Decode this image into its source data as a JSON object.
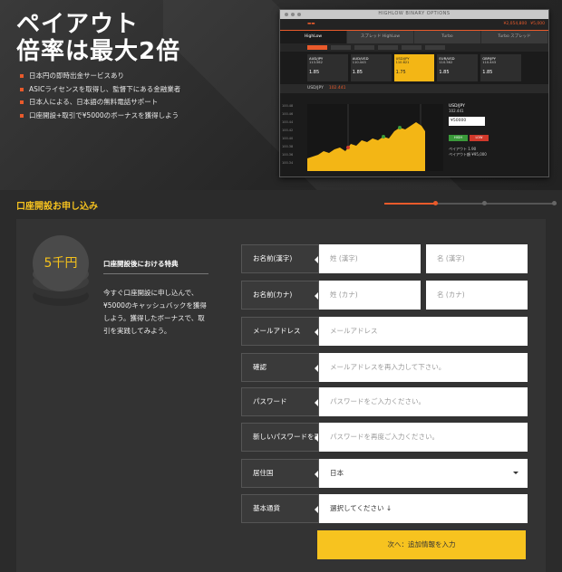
{
  "hero": {
    "title_line1": "ペイアウト",
    "title_line2": "倍率は最大2倍",
    "features": [
      "日本円の即時出金サービスあり",
      "ASICライセンスを取得し、監督下にある金融業者",
      "日本人による、日本語の無料電話サポート",
      "口座開設+取引で¥5000のボーナスを獲得しよう"
    ]
  },
  "mockup": {
    "brand": "HIGHLOW BINARY OPTIONS",
    "balance": "¥2,054,800",
    "bonus": "¥5,000",
    "tabs": [
      "HighLow",
      "スプレッド HighLow",
      "Turbo",
      "Turbo スプレッド"
    ],
    "assets": [
      {
        "name": "AUD/JPY",
        "price": "1.85"
      },
      {
        "name": "AUD/USD",
        "price": "1.85"
      },
      {
        "name": "USD/JPY",
        "price": "1.75"
      },
      {
        "name": "EUR/USD",
        "price": "1.85"
      },
      {
        "name": "GBP/JPY",
        "price": "1.85"
      }
    ],
    "asset_values": [
      "113.562",
      "110.443",
      "110.621",
      "110.562",
      "110.443"
    ],
    "pair": "USD/JPY",
    "pair_price": "102.441",
    "side_pair": "USD/JPY",
    "side_price": "102.441",
    "amount": "¥50000",
    "high_label": "HIGH",
    "low_label": "LOW",
    "payout_label": "ペイアウト",
    "payout_value": "1.90",
    "return_label": "ペイアウト額",
    "return_value": "¥95,000",
    "axis": [
      "100.48",
      "100.46",
      "100.44",
      "100.42",
      "100.40",
      "100.38",
      "100.36",
      "100.34"
    ]
  },
  "section": {
    "title": "口座開設お申し込み"
  },
  "bonus": {
    "coin_text": "5千円",
    "title": "口座開設後における特典",
    "text": "今すぐ口座開設に申し込んで、¥5000のキャッシュバックを獲得しよう。獲得したボーナスで、取引を実践してみよう。"
  },
  "form": {
    "name_kanji": {
      "label": "お名前(漢字)",
      "last": "姓 (漢字)",
      "first": "名 (漢字)"
    },
    "name_kana": {
      "label": "お名前(カナ)",
      "last": "姓 (カナ)",
      "first": "名 (カナ)"
    },
    "email": {
      "label": "メールアドレス",
      "placeholder": "メールアドレス"
    },
    "confirm": {
      "label": "確認",
      "placeholder": "メールアドレスを再入力して下さい。"
    },
    "password": {
      "label": "パスワード",
      "placeholder": "パスワードをご入力ください。"
    },
    "password_new": {
      "label": "新しいパスワードを再",
      "placeholder": "パスワードを再度ご入力ください。"
    },
    "country": {
      "label": "居住国",
      "value": "日本"
    },
    "currency": {
      "label": "基本通貨",
      "value": "選択してください ↓"
    },
    "next_label": "次へ：追加情報を入力"
  },
  "colors": {
    "accent": "#e95a2b",
    "gold": "#f7c31f",
    "panel": "#333333"
  }
}
